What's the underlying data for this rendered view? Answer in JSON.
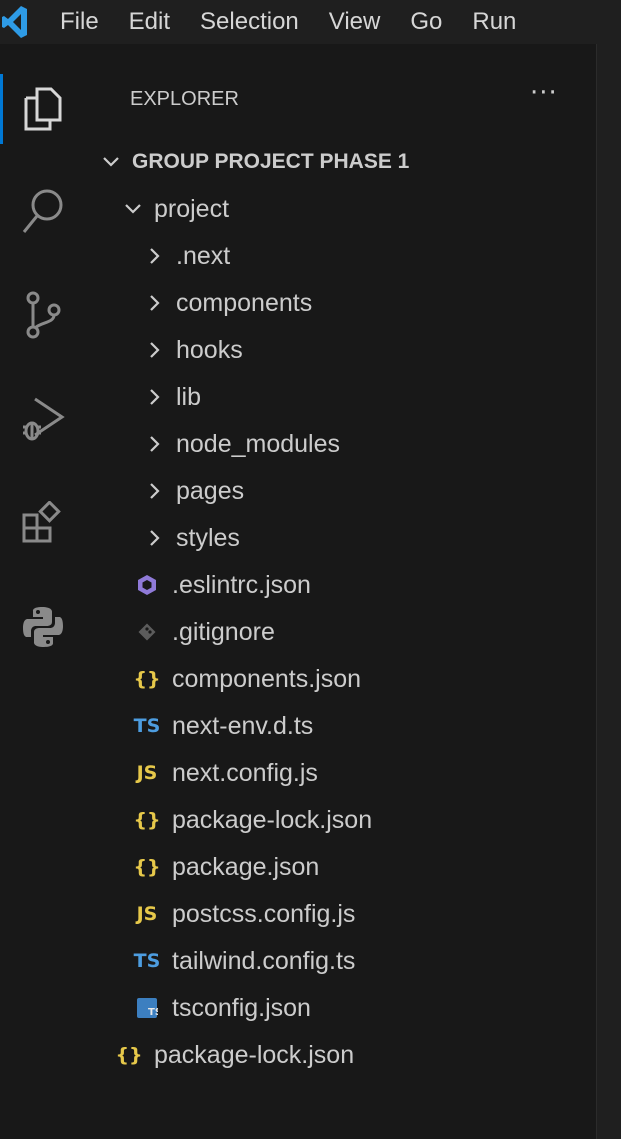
{
  "menubar": {
    "items": [
      "File",
      "Edit",
      "Selection",
      "View",
      "Go",
      "Run"
    ]
  },
  "activitybar": {
    "icons": [
      "explorer-icon",
      "search-icon",
      "source-control-icon",
      "run-debug-icon",
      "extensions-icon",
      "python-icon"
    ]
  },
  "explorer": {
    "title": "EXPLORER",
    "more": "···",
    "root": "GROUP PROJECT PHASE 1",
    "project_folder": "project",
    "folders": [
      ".next",
      "components",
      "hooks",
      "lib",
      "node_modules",
      "pages",
      "styles"
    ],
    "files": [
      {
        "name": ".eslintrc.json",
        "icon": "eslint-icon",
        "glyph": ""
      },
      {
        "name": ".gitignore",
        "icon": "git-icon",
        "glyph": ""
      },
      {
        "name": "components.json",
        "icon": "json-icon",
        "glyph": "{}"
      },
      {
        "name": "next-env.d.ts",
        "icon": "typescript-icon",
        "glyph": "TS"
      },
      {
        "name": "next.config.js",
        "icon": "javascript-icon",
        "glyph": "JS"
      },
      {
        "name": "package-lock.json",
        "icon": "json-icon",
        "glyph": "{}"
      },
      {
        "name": "package.json",
        "icon": "json-icon",
        "glyph": "{}"
      },
      {
        "name": "postcss.config.js",
        "icon": "javascript-icon",
        "glyph": "JS"
      },
      {
        "name": "tailwind.config.ts",
        "icon": "typescript-icon",
        "glyph": "TS"
      },
      {
        "name": "tsconfig.json",
        "icon": "tsconfig-icon",
        "glyph": "TS"
      }
    ],
    "root_files": [
      {
        "name": "package-lock.json",
        "icon": "json-icon",
        "glyph": "{}"
      }
    ]
  },
  "colors": {
    "background": "#181818",
    "text": "#cccccc",
    "accent": "#0078d4",
    "ts_blue": "#4d9de0",
    "js_yellow": "#e6c84a",
    "eslint_purple": "#8f7ad8"
  }
}
